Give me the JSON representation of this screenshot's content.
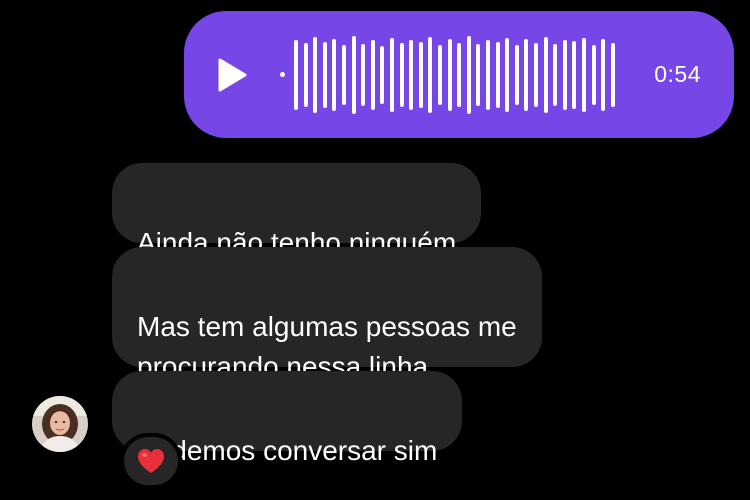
{
  "theme": {
    "background": "#000000",
    "voice_bubble_color": "#7646e6",
    "incoming_bubble_color": "#262626",
    "reaction_bubble_color": "#262626",
    "heart_color": "#e8303c"
  },
  "voice_message": {
    "duration": "0:54",
    "play_icon": "play-icon"
  },
  "messages": [
    {
      "text": "Ainda não tenho ninguém"
    },
    {
      "text": "Mas tem algumas pessoas me\nprocurando nessa linha"
    },
    {
      "text": "Podemos conversar sim"
    }
  ],
  "reaction": {
    "icon": "heart-icon"
  },
  "avatar": {
    "icon": "contact-avatar"
  }
}
